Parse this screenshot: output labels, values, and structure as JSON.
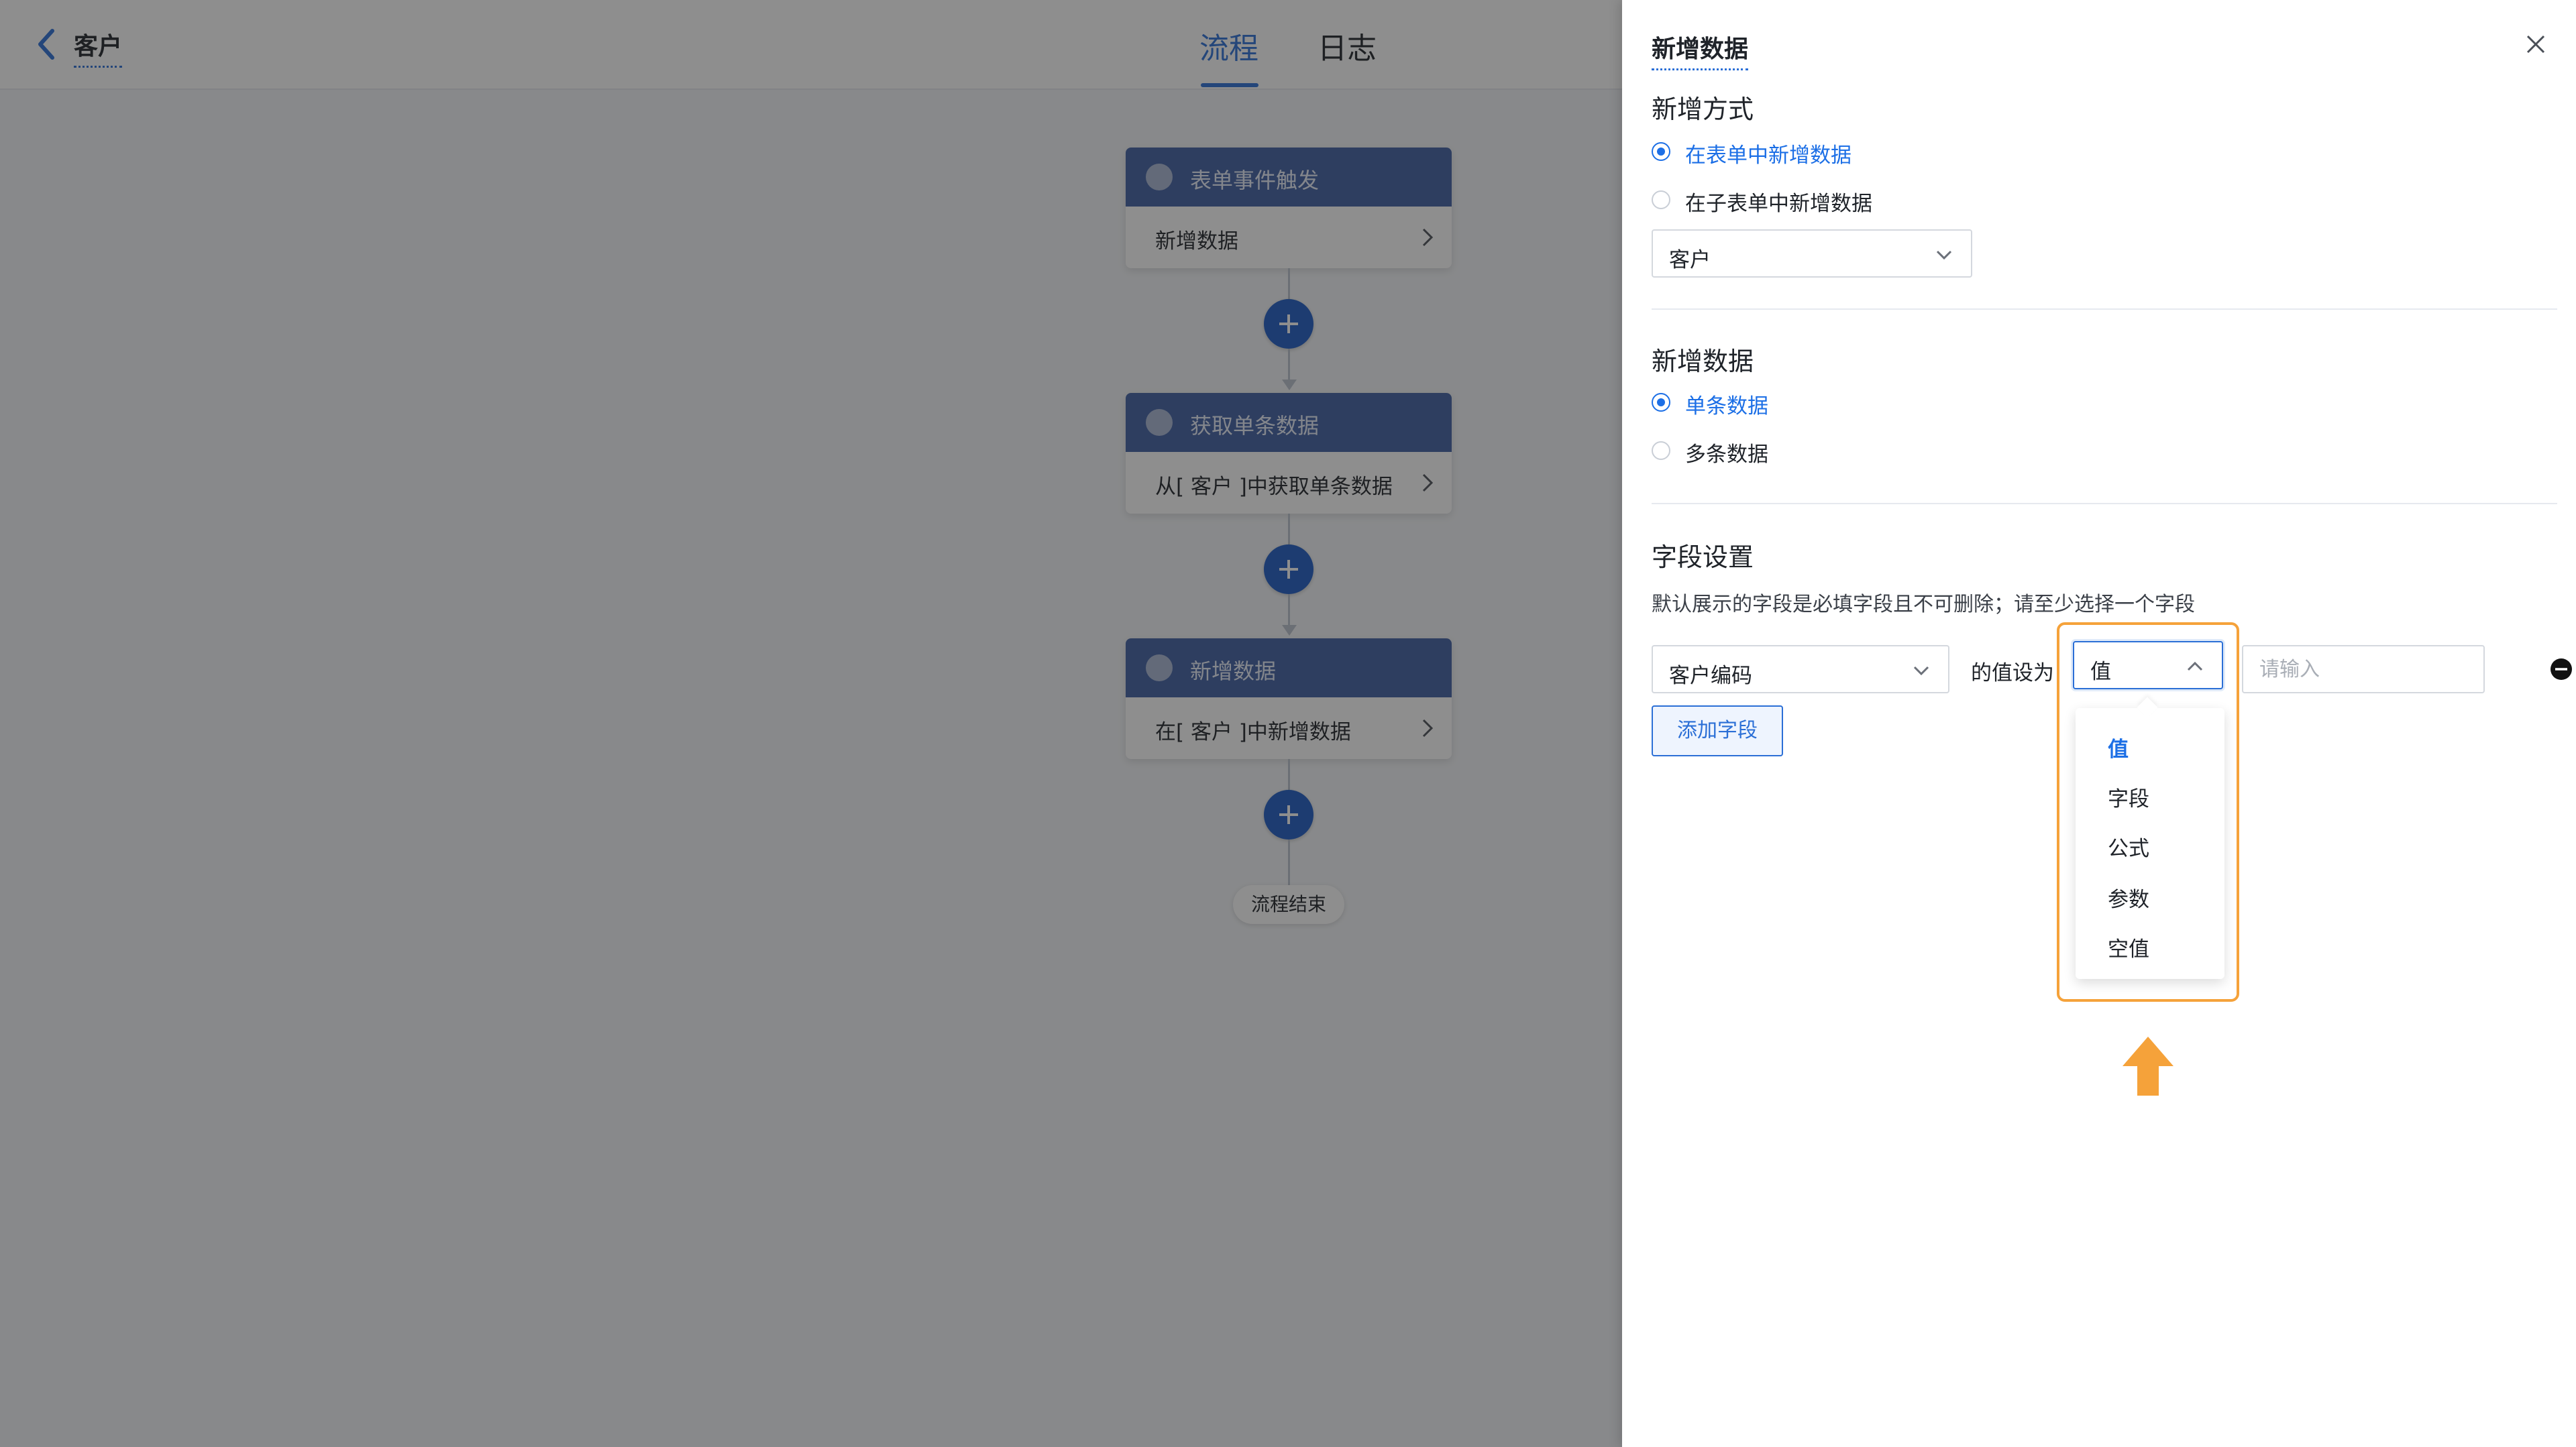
{
  "header": {
    "app_title": "客户",
    "tabs": [
      {
        "label": "流程",
        "active": true
      },
      {
        "label": "日志",
        "active": false
      }
    ]
  },
  "flow": {
    "nodes": [
      {
        "title": "表单事件触发",
        "description": "新增数据",
        "icon": "document-icon"
      },
      {
        "title": "获取单条数据",
        "description": "从[ 客户 ]中获取单条数据",
        "icon": "document-icon"
      },
      {
        "title": "新增数据",
        "description": "在[ 客户 ]中新增数据",
        "icon": "plus-circle-icon"
      }
    ],
    "end_label": "流程结束"
  },
  "drawer": {
    "title": "新增数据",
    "add_method": {
      "title": "新增方式",
      "options": [
        {
          "label": "在表单中新增数据",
          "checked": true
        },
        {
          "label": "在子表单中新增数据",
          "checked": false
        }
      ],
      "form_select_value": "客户"
    },
    "add_data": {
      "title": "新增数据",
      "options": [
        {
          "label": "单条数据",
          "checked": true
        },
        {
          "label": "多条数据",
          "checked": false
        }
      ]
    },
    "field_settings": {
      "title": "字段设置",
      "hint": "默认展示的字段是必填字段且不可删除；请至少选择一个字段",
      "field_select_value": "客户编码",
      "set_to_label": "的值设为",
      "type_select_value": "值",
      "value_placeholder": "请输入",
      "type_options": [
        "值",
        "字段",
        "公式",
        "参数",
        "空值"
      ],
      "active_type_option": "值",
      "add_field_label": "添加字段"
    }
  },
  "colors": {
    "accent": "#1c6fe6",
    "node_header": "#3f5fa3",
    "highlight": "#f5a23a"
  }
}
